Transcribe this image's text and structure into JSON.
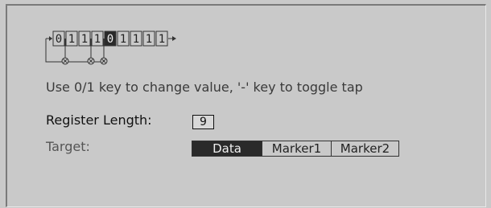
{
  "register": {
    "bits": [
      "0",
      "1",
      "1",
      "1",
      "0",
      "1",
      "1",
      "1",
      "1"
    ],
    "selected_index": 4,
    "taps_after_bits": [
      1,
      3,
      4
    ]
  },
  "hint": "Use 0/1 key to change value, '-' key to toggle tap",
  "register_length": {
    "label": "Register Length:",
    "value": "9"
  },
  "target": {
    "label": "Target:",
    "options": [
      "Data",
      "Marker1",
      "Marker2"
    ],
    "selected": "Data"
  },
  "colors": {
    "background": "#c9c9c9",
    "selected_fill": "#2a2a2a",
    "selected_text": "#f0f0f0"
  }
}
